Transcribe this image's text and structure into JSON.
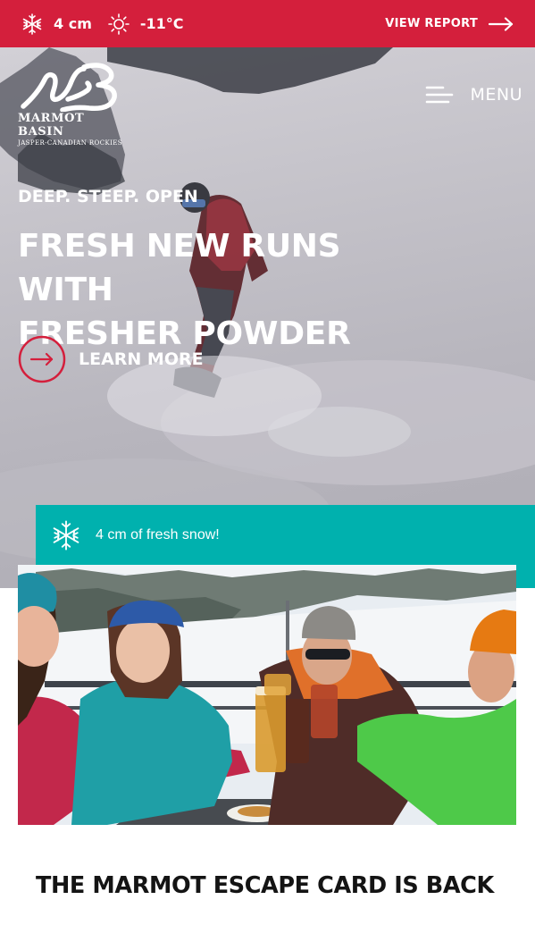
{
  "conditions": {
    "snowfall": "4 cm",
    "temperature": "-11°C",
    "view_report_label": "VIEW REPORT"
  },
  "brand": {
    "name": "MARMOT BASIN",
    "tagline": "JASPER-CANADIAN ROCKIES"
  },
  "nav": {
    "menu_label": "MENU"
  },
  "hero": {
    "eyebrow": "DEEP. STEEP. OPEN",
    "headline_line1": "FRESH NEW RUNS WITH",
    "headline_line2": "FRESHER POWDER",
    "cta_label": "LEARN MORE"
  },
  "notice": {
    "text": "4 cm of fresh snow!"
  },
  "section": {
    "title": "THE MARMOT ESCAPE CARD IS BACK"
  },
  "colors": {
    "brand_red": "#d41f3c",
    "notice_teal": "#00b1ae",
    "text_dark": "#141414"
  },
  "icons": {
    "snow": "snowflake-icon",
    "temperature": "sun-icon",
    "arrow": "arrow-right-icon",
    "menu": "menu-lines-icon"
  }
}
